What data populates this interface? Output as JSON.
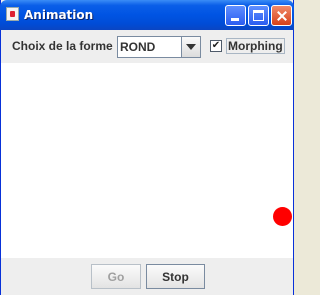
{
  "window": {
    "title": "Animation",
    "app_icon": "java-icon"
  },
  "toolbar": {
    "shape_label": "Choix de la forme",
    "shape_value": "ROND",
    "morphing_label": "Morphing",
    "morphing_checked": true
  },
  "canvas": {
    "shape": "circle",
    "shape_color": "#ff0000"
  },
  "footer": {
    "go_label": "Go",
    "go_enabled": false,
    "stop_label": "Stop"
  },
  "colors": {
    "titlebar": "#0054e3",
    "background": "#eeeeee",
    "canvas": "#ffffff"
  }
}
